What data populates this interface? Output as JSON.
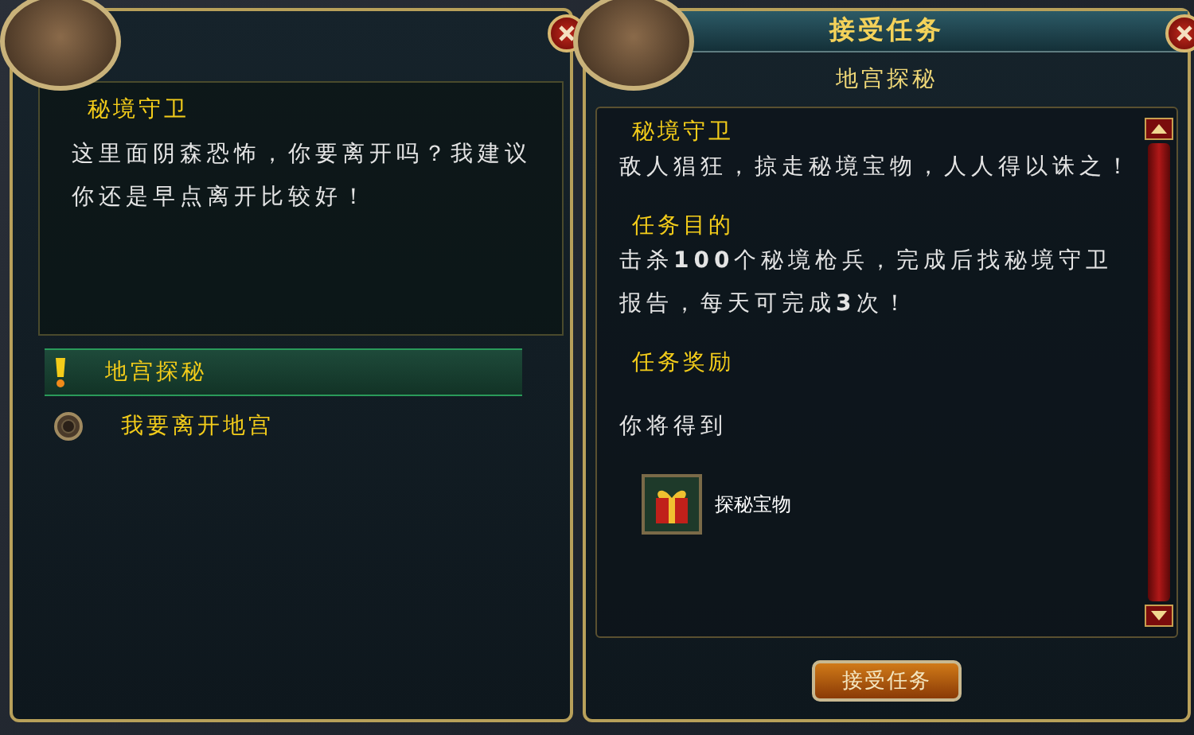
{
  "left_panel": {
    "npc_name": "秘境守卫",
    "dialogue": "这里面阴森恐怖，你要离开吗？我建议你还是早点离开比较好！",
    "options": [
      {
        "kind": "quest",
        "label": "地宫探秘",
        "selected": true
      },
      {
        "kind": "leave",
        "label": "我要离开地宫",
        "selected": false
      }
    ]
  },
  "right_panel": {
    "title": "接受任务",
    "quest_name": "地宫探秘",
    "sections": [
      {
        "heading": "秘境守卫",
        "body": "敌人猖狂，掠走秘境宝物，人人得以诛之！"
      },
      {
        "heading": "任务目的",
        "body": "击杀**100**个秘境枪兵，完成后找秘境守卫报告，每天可完成**3**次！"
      },
      {
        "heading": "任务奖励",
        "body": "你将得到"
      }
    ],
    "rewards": [
      {
        "name": "探秘宝物"
      }
    ],
    "accept_button": "接受任务"
  }
}
